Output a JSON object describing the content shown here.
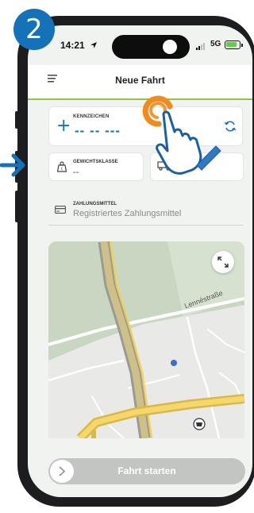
{
  "step": {
    "number": "2",
    "color": "#1372b8"
  },
  "status_bar": {
    "time": "14:21",
    "network": "5G",
    "battery_color": "#5bd13c"
  },
  "header": {
    "title": "Neue Fahrt",
    "accent": "#8dc63f"
  },
  "plate": {
    "label": "KENNZEICHEN",
    "value": "-- -- ---",
    "color": "#1372b8"
  },
  "weight": {
    "label": "GEWICHTSKLASSE",
    "value": "--"
  },
  "vehicle": {
    "value": "--"
  },
  "payment": {
    "label": "ZAHLUNGSMITTEL",
    "value": "Registriertes Zahlungsmittel"
  },
  "map": {
    "street_label": "Lennéstraße"
  },
  "start": {
    "label": "Fahrt starten"
  },
  "icons": [
    "location-arrow-icon",
    "signal-icon",
    "battery-icon",
    "hamburger-menu-icon",
    "plus-icon",
    "refresh-icon",
    "weight-icon",
    "truck-icon",
    "credit-card-icon",
    "expand-icon",
    "chevron-right-icon",
    "hand-pointer-icon",
    "arrow-right-icon"
  ]
}
